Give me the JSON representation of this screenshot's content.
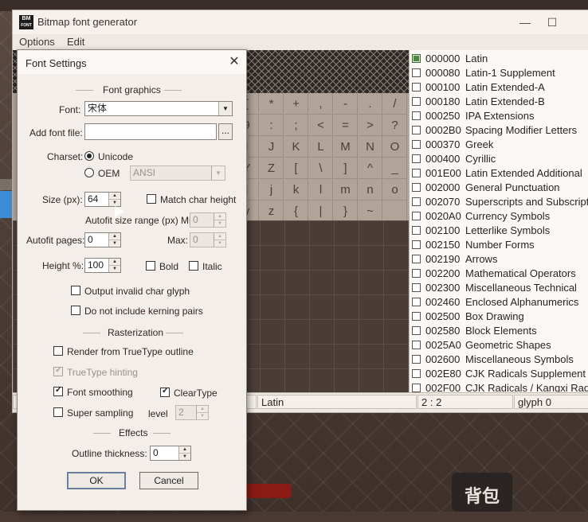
{
  "background": {
    "game_button_label": "背包"
  },
  "main_window": {
    "title": "Bitmap font generator",
    "logo_text_top": "BM",
    "logo_text_bottom": "FONT",
    "controls": {
      "minimize": "—",
      "maximize": "☐",
      "close": "✕"
    },
    "menu": [
      "Options",
      "Edit"
    ],
    "glyph_rows": [
      [
        "",
        "",
        "",
        "",
        "",
        "(",
        "*",
        "+",
        ",",
        "-",
        ".",
        "/"
      ],
      [
        "",
        "",
        "",
        "",
        "",
        "9",
        ":",
        ";",
        "<",
        "=",
        ">",
        "?",
        ""
      ],
      [
        "",
        "",
        "",
        "",
        "",
        "I",
        "J",
        "K",
        "L",
        "M",
        "N",
        "O"
      ],
      [
        "",
        "",
        "",
        "",
        "",
        "Y",
        "Z",
        "[",
        "\\",
        "]",
        "^",
        "_"
      ],
      [
        "",
        "",
        "",
        "",
        "",
        "i",
        "j",
        "k",
        "l",
        "m",
        "n",
        "o"
      ],
      [
        "",
        "",
        "",
        "",
        "",
        "y",
        "z",
        "{",
        "|",
        "}",
        "~",
        ""
      ]
    ],
    "status": {
      "left": "s",
      "subset": "Latin",
      "position": "2 : 2",
      "glyph": "glyph 0"
    },
    "subsets": [
      {
        "code": "000000",
        "name": "Latin",
        "checked": true
      },
      {
        "code": "000080",
        "name": "Latin-1 Supplement",
        "checked": false
      },
      {
        "code": "000100",
        "name": "Latin Extended-A",
        "checked": false
      },
      {
        "code": "000180",
        "name": "Latin Extended-B",
        "checked": false
      },
      {
        "code": "000250",
        "name": "IPA Extensions",
        "checked": false
      },
      {
        "code": "0002B0",
        "name": "Spacing Modifier Letters",
        "checked": false
      },
      {
        "code": "000370",
        "name": "Greek",
        "checked": false
      },
      {
        "code": "000400",
        "name": "Cyrillic",
        "checked": false
      },
      {
        "code": "001E00",
        "name": "Latin Extended Additional",
        "checked": false
      },
      {
        "code": "002000",
        "name": "General Punctuation",
        "checked": false
      },
      {
        "code": "002070",
        "name": "Superscripts and Subscripts",
        "checked": false
      },
      {
        "code": "0020A0",
        "name": "Currency Symbols",
        "checked": false
      },
      {
        "code": "002100",
        "name": "Letterlike Symbols",
        "checked": false
      },
      {
        "code": "002150",
        "name": "Number Forms",
        "checked": false
      },
      {
        "code": "002190",
        "name": "Arrows",
        "checked": false
      },
      {
        "code": "002200",
        "name": "Mathematical Operators",
        "checked": false
      },
      {
        "code": "002300",
        "name": "Miscellaneous Technical",
        "checked": false
      },
      {
        "code": "002460",
        "name": "Enclosed Alphanumerics",
        "checked": false
      },
      {
        "code": "002500",
        "name": "Box Drawing",
        "checked": false
      },
      {
        "code": "002580",
        "name": "Block Elements",
        "checked": false
      },
      {
        "code": "0025A0",
        "name": "Geometric Shapes",
        "checked": false
      },
      {
        "code": "002600",
        "name": "Miscellaneous Symbols",
        "checked": false
      },
      {
        "code": "002E80",
        "name": "CJK Radicals Supplement",
        "checked": false
      },
      {
        "code": "002F00",
        "name": "CJK Radicals / Kangxi Radicals",
        "checked": false
      }
    ]
  },
  "dialog": {
    "title": "Font Settings",
    "close": "✕",
    "sections": {
      "graphics": "Font graphics",
      "rasterization": "Rasterization",
      "effects": "Effects"
    },
    "font": {
      "label": "Font:",
      "value": "宋体"
    },
    "add_font_file": {
      "label": "Add font file:",
      "value": "",
      "browse": "..."
    },
    "charset": {
      "label": "Charset:",
      "unicode": "Unicode",
      "oem": "OEM",
      "oem_value": "ANSI",
      "selected": "Unicode"
    },
    "size": {
      "label": "Size (px):",
      "value": "64"
    },
    "match_char_height": {
      "label": "Match char height",
      "checked": false
    },
    "autofit_range": {
      "label": "Autofit size range (px) Min:",
      "min": "0",
      "max_label": "Max:",
      "max": "0"
    },
    "autofit_pages": {
      "label": "Autofit pages:",
      "value": "0"
    },
    "height_percent": {
      "label": "Height %:",
      "value": "100"
    },
    "bold": {
      "label": "Bold",
      "checked": false
    },
    "italic": {
      "label": "Italic",
      "checked": false
    },
    "output_invalid": {
      "label": "Output invalid char glyph",
      "checked": false
    },
    "no_kerning": {
      "label": "Do not include kerning pairs",
      "checked": false
    },
    "render_truetype": {
      "label": "Render from TrueType outline",
      "checked": false
    },
    "truetype_hinting": {
      "label": "TrueType hinting",
      "checked": true,
      "enabled": false
    },
    "font_smoothing": {
      "label": "Font smoothing",
      "checked": true
    },
    "cleartype": {
      "label": "ClearType",
      "checked": true
    },
    "super_sampling": {
      "label": "Super sampling",
      "checked": false,
      "level_label": "level",
      "level": "2"
    },
    "outline_thickness": {
      "label": "Outline thickness:",
      "value": "0"
    },
    "ok": "OK",
    "cancel": "Cancel",
    "check_glyph": "✓"
  }
}
